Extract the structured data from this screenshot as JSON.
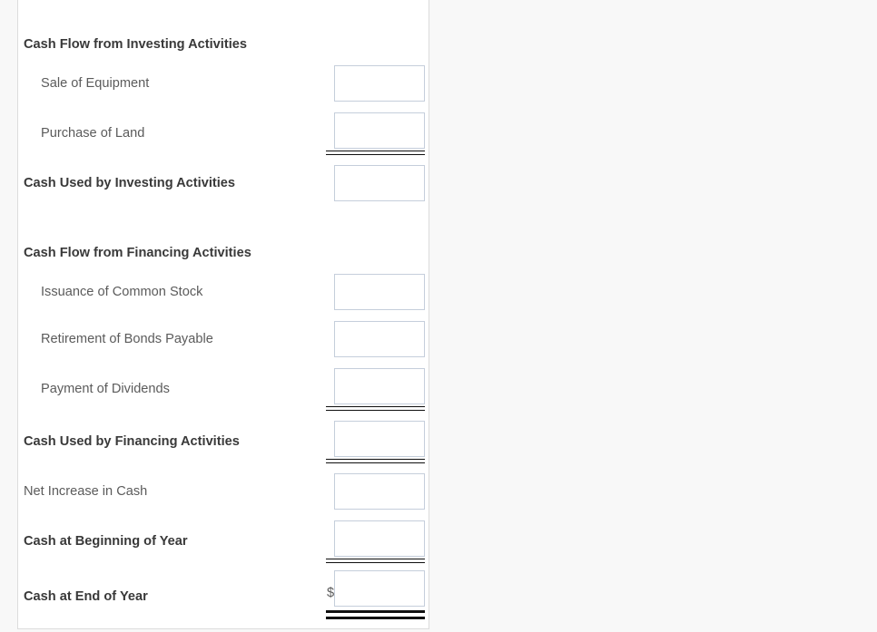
{
  "statement": {
    "sections": [
      {
        "heading": "Cash Flow from Investing Activities",
        "items": [
          {
            "label": "Sale of Equipment",
            "value": "",
            "placeholder": ""
          },
          {
            "label": "Purchase of Land",
            "value": "",
            "placeholder": ""
          }
        ],
        "subtotal": {
          "label": "Cash Used by Investing Activities",
          "value": "",
          "placeholder": ""
        }
      },
      {
        "heading": "Cash Flow from Financing Activities",
        "items": [
          {
            "label": "Issuance of Common Stock",
            "value": "",
            "placeholder": ""
          },
          {
            "label": "Retirement of Bonds Payable",
            "value": "",
            "placeholder": ""
          },
          {
            "label": "Payment of Dividends",
            "value": "",
            "placeholder": ""
          }
        ],
        "subtotal": {
          "label": "Cash Used by Financing Activities",
          "value": "",
          "placeholder": ""
        }
      }
    ],
    "summary": [
      {
        "label": "Net Increase in Cash",
        "value": "",
        "placeholder": "",
        "bold": false
      },
      {
        "label": "Cash at Beginning of Year",
        "value": "",
        "placeholder": "",
        "bold": true
      },
      {
        "label": "Cash at End of Year",
        "value": "",
        "placeholder": "",
        "bold": true,
        "currency": "$"
      }
    ]
  },
  "colors": {
    "input_border": "#c5cedb",
    "heading_text": "#393939",
    "item_text": "#5b5b5b",
    "rule": "#101010",
    "panel_bg": "#ffffff",
    "page_bg": "#f8f8f8"
  }
}
